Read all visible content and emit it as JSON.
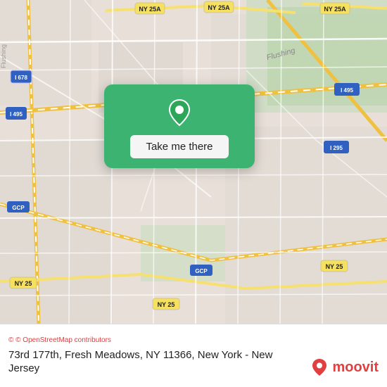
{
  "map": {
    "background_color": "#e8e0d8",
    "alt": "Map of Fresh Meadows, NY area"
  },
  "location_card": {
    "button_label": "Take me there",
    "pin_icon": "location-pin-icon"
  },
  "footer": {
    "osm_credit": "© OpenStreetMap contributors",
    "address": "73rd 177th, Fresh Meadows, NY 11366, New York - New Jersey",
    "logo_text": "moovit"
  }
}
